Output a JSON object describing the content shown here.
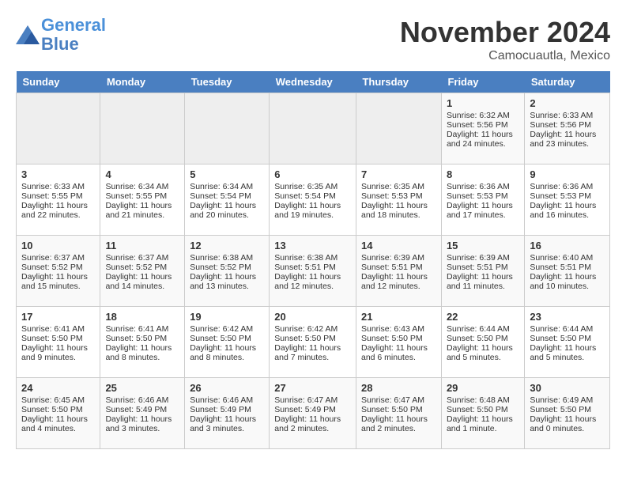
{
  "header": {
    "logo_line1": "General",
    "logo_line2": "Blue",
    "month": "November 2024",
    "location": "Camocuautla, Mexico"
  },
  "weekdays": [
    "Sunday",
    "Monday",
    "Tuesday",
    "Wednesday",
    "Thursday",
    "Friday",
    "Saturday"
  ],
  "weeks": [
    [
      {
        "day": "",
        "info": ""
      },
      {
        "day": "",
        "info": ""
      },
      {
        "day": "",
        "info": ""
      },
      {
        "day": "",
        "info": ""
      },
      {
        "day": "",
        "info": ""
      },
      {
        "day": "1",
        "info": "Sunrise: 6:32 AM\nSunset: 5:56 PM\nDaylight: 11 hours\nand 24 minutes."
      },
      {
        "day": "2",
        "info": "Sunrise: 6:33 AM\nSunset: 5:56 PM\nDaylight: 11 hours\nand 23 minutes."
      }
    ],
    [
      {
        "day": "3",
        "info": "Sunrise: 6:33 AM\nSunset: 5:55 PM\nDaylight: 11 hours\nand 22 minutes."
      },
      {
        "day": "4",
        "info": "Sunrise: 6:34 AM\nSunset: 5:55 PM\nDaylight: 11 hours\nand 21 minutes."
      },
      {
        "day": "5",
        "info": "Sunrise: 6:34 AM\nSunset: 5:54 PM\nDaylight: 11 hours\nand 20 minutes."
      },
      {
        "day": "6",
        "info": "Sunrise: 6:35 AM\nSunset: 5:54 PM\nDaylight: 11 hours\nand 19 minutes."
      },
      {
        "day": "7",
        "info": "Sunrise: 6:35 AM\nSunset: 5:53 PM\nDaylight: 11 hours\nand 18 minutes."
      },
      {
        "day": "8",
        "info": "Sunrise: 6:36 AM\nSunset: 5:53 PM\nDaylight: 11 hours\nand 17 minutes."
      },
      {
        "day": "9",
        "info": "Sunrise: 6:36 AM\nSunset: 5:53 PM\nDaylight: 11 hours\nand 16 minutes."
      }
    ],
    [
      {
        "day": "10",
        "info": "Sunrise: 6:37 AM\nSunset: 5:52 PM\nDaylight: 11 hours\nand 15 minutes."
      },
      {
        "day": "11",
        "info": "Sunrise: 6:37 AM\nSunset: 5:52 PM\nDaylight: 11 hours\nand 14 minutes."
      },
      {
        "day": "12",
        "info": "Sunrise: 6:38 AM\nSunset: 5:52 PM\nDaylight: 11 hours\nand 13 minutes."
      },
      {
        "day": "13",
        "info": "Sunrise: 6:38 AM\nSunset: 5:51 PM\nDaylight: 11 hours\nand 12 minutes."
      },
      {
        "day": "14",
        "info": "Sunrise: 6:39 AM\nSunset: 5:51 PM\nDaylight: 11 hours\nand 12 minutes."
      },
      {
        "day": "15",
        "info": "Sunrise: 6:39 AM\nSunset: 5:51 PM\nDaylight: 11 hours\nand 11 minutes."
      },
      {
        "day": "16",
        "info": "Sunrise: 6:40 AM\nSunset: 5:51 PM\nDaylight: 11 hours\nand 10 minutes."
      }
    ],
    [
      {
        "day": "17",
        "info": "Sunrise: 6:41 AM\nSunset: 5:50 PM\nDaylight: 11 hours\nand 9 minutes."
      },
      {
        "day": "18",
        "info": "Sunrise: 6:41 AM\nSunset: 5:50 PM\nDaylight: 11 hours\nand 8 minutes."
      },
      {
        "day": "19",
        "info": "Sunrise: 6:42 AM\nSunset: 5:50 PM\nDaylight: 11 hours\nand 8 minutes."
      },
      {
        "day": "20",
        "info": "Sunrise: 6:42 AM\nSunset: 5:50 PM\nDaylight: 11 hours\nand 7 minutes."
      },
      {
        "day": "21",
        "info": "Sunrise: 6:43 AM\nSunset: 5:50 PM\nDaylight: 11 hours\nand 6 minutes."
      },
      {
        "day": "22",
        "info": "Sunrise: 6:44 AM\nSunset: 5:50 PM\nDaylight: 11 hours\nand 5 minutes."
      },
      {
        "day": "23",
        "info": "Sunrise: 6:44 AM\nSunset: 5:50 PM\nDaylight: 11 hours\nand 5 minutes."
      }
    ],
    [
      {
        "day": "24",
        "info": "Sunrise: 6:45 AM\nSunset: 5:50 PM\nDaylight: 11 hours\nand 4 minutes."
      },
      {
        "day": "25",
        "info": "Sunrise: 6:46 AM\nSunset: 5:49 PM\nDaylight: 11 hours\nand 3 minutes."
      },
      {
        "day": "26",
        "info": "Sunrise: 6:46 AM\nSunset: 5:49 PM\nDaylight: 11 hours\nand 3 minutes."
      },
      {
        "day": "27",
        "info": "Sunrise: 6:47 AM\nSunset: 5:49 PM\nDaylight: 11 hours\nand 2 minutes."
      },
      {
        "day": "28",
        "info": "Sunrise: 6:47 AM\nSunset: 5:50 PM\nDaylight: 11 hours\nand 2 minutes."
      },
      {
        "day": "29",
        "info": "Sunrise: 6:48 AM\nSunset: 5:50 PM\nDaylight: 11 hours\nand 1 minute."
      },
      {
        "day": "30",
        "info": "Sunrise: 6:49 AM\nSunset: 5:50 PM\nDaylight: 11 hours\nand 0 minutes."
      }
    ]
  ]
}
